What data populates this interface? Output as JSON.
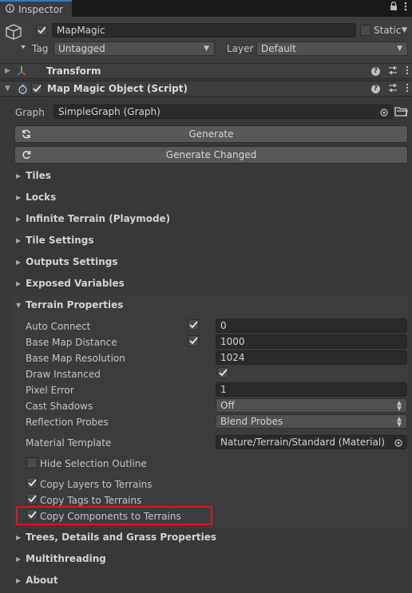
{
  "window": {
    "tab_label": "Inspector"
  },
  "object": {
    "name": "MapMagic",
    "active": true,
    "static_label": "Static",
    "tag_label": "Tag",
    "tag_value": "Untagged",
    "layer_label": "Layer",
    "layer_value": "Default"
  },
  "components": [
    {
      "name": "Transform",
      "expanded": false
    },
    {
      "name": "Map Magic Object (Script)",
      "expanded": true,
      "enabled": true
    }
  ],
  "graph": {
    "label": "Graph",
    "value": "SimpleGraph (Graph)"
  },
  "buttons": {
    "generate": "Generate",
    "generate_changed": "Generate Changed"
  },
  "sections": {
    "tiles": "Tiles",
    "locks": "Locks",
    "infinite_terrain": "Infinite Terrain (Playmode)",
    "tile_settings": "Tile Settings",
    "outputs_settings": "Outputs Settings",
    "exposed_variables": "Exposed Variables",
    "terrain_properties": "Terrain Properties",
    "trees": "Trees, Details and Grass Properties",
    "multithreading": "Multithreading",
    "about": "About"
  },
  "terrain": {
    "auto_connect": {
      "label": "Auto Connect",
      "checked": true,
      "value": "0"
    },
    "base_map_distance": {
      "label": "Base Map Distance",
      "checked": true,
      "value": "1000"
    },
    "base_map_resolution": {
      "label": "Base Map Resolution",
      "value": "1024"
    },
    "draw_instanced": {
      "label": "Draw Instanced",
      "checked": true
    },
    "pixel_error": {
      "label": "Pixel Error",
      "value": "1"
    },
    "cast_shadows": {
      "label": "Cast Shadows",
      "value": "Off"
    },
    "reflection_probes": {
      "label": "Reflection Probes",
      "value": "Blend Probes"
    },
    "material_template": {
      "label": "Material Template",
      "value": "Nature/Terrain/Standard (Material)"
    },
    "hide_selection_outline": {
      "label": "Hide Selection Outline",
      "checked": false
    },
    "copy_layers": {
      "label": "Copy Layers to Terrains",
      "checked": true
    },
    "copy_tags": {
      "label": "Copy Tags to Terrains",
      "checked": true
    },
    "copy_components": {
      "label": "Copy Components to Terrains",
      "checked": true
    }
  },
  "colors": {
    "background": "#383838",
    "accent": "#3a79bb",
    "highlight": "#e3151b"
  }
}
